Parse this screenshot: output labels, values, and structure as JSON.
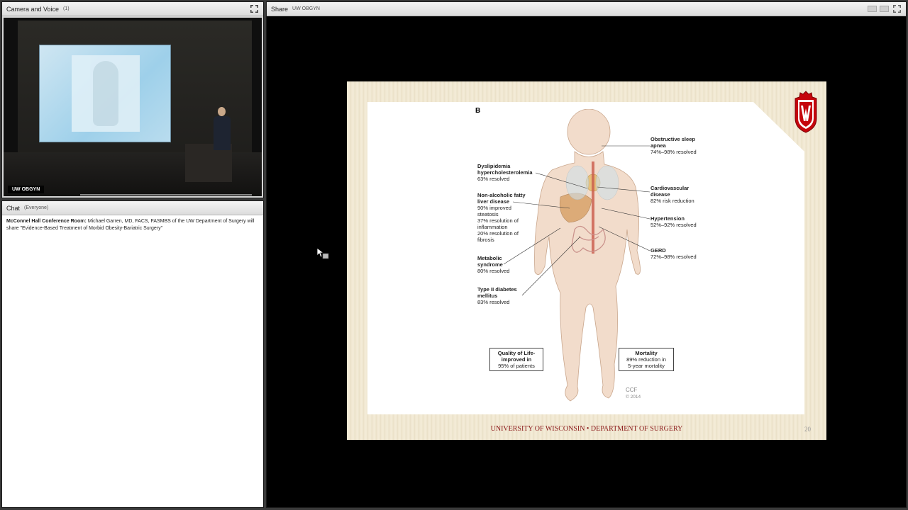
{
  "camera_pod": {
    "title": "Camera and Voice",
    "count": "(1)",
    "video_label": "UW OBGYN"
  },
  "chat_pod": {
    "title": "Chat",
    "audience": "(Everyone)",
    "messages": [
      {
        "sender": "McConnel Hall Conference Room:",
        "text": "Michael Garren, MD, FACS, FASMBS of the UW Department of Surgery will share \"Evidence-Based Treatment of Morbid Obesity-Bariatric Surgery\""
      }
    ]
  },
  "share_pod": {
    "title": "Share",
    "presenter": "UW OBGYN"
  },
  "slide": {
    "panel_letter": "B",
    "footer": "UNIVERSITY OF WISCONSIN • DEPARTMENT OF SURGERY",
    "page_number": "20",
    "credit_line1": "CCF",
    "credit_line2": "© 2014",
    "labels": {
      "dyslipidemia_title": "Dyslipidemia hypercholesterolemia",
      "dyslipidemia_value": "63% resolved",
      "nafld_title": "Non-alcoholic fatty liver disease",
      "nafld_l1": "90% improved steatosis",
      "nafld_l2": "37% resolution of inflammation",
      "nafld_l3": "20% resolution of fibrosis",
      "metabolic_title": "Metabolic syndrome",
      "metabolic_value": "80% resolved",
      "diabetes_title": "Type II diabetes mellitus",
      "diabetes_value": "83% resolved",
      "osa_title": "Obstructive sleep apnea",
      "osa_value": "74%–98% resolved",
      "cardio_title": "Cardiovascular disease",
      "cardio_value": "82% risk reduction",
      "htn_title": "Hypertension",
      "htn_value": "52%–92% resolved",
      "gerd_title": "GERD",
      "gerd_value": "72%–98% resolved",
      "qol_title": "Quality of Life-",
      "qol_l2": "improved in",
      "qol_l3": "95% of patients",
      "mortality_title": "Mortality",
      "mortality_l2": "89% reduction in",
      "mortality_l3": "5-year mortality"
    }
  },
  "colors": {
    "footer_red": "#8c1b1b",
    "crest_red": "#c5050c",
    "slide_beige": "#efe6d0"
  },
  "icons": [
    "fullscreen-icon",
    "pod-menu-icon",
    "mouse-cursor-icon",
    "uw-crest-icon"
  ]
}
